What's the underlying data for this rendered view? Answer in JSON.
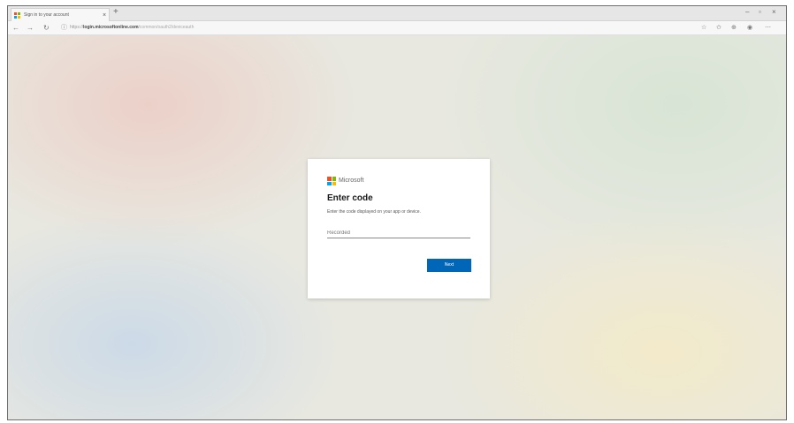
{
  "browser": {
    "tab_title": "Sign in to your account",
    "tab_close": "×",
    "new_tab": "+",
    "window_controls": {
      "minimize": "–",
      "maximize": "▫",
      "close": "×"
    },
    "nav": {
      "back": "←",
      "forward": "→",
      "refresh": "↻",
      "lock": "ⓘ"
    },
    "url": {
      "scheme": "https://",
      "host": "login.microsoftonline.com",
      "path": "/common/oauth2/deviceauth"
    },
    "toolbar_icons": [
      "☆",
      "✩",
      "⊕",
      "◉",
      "⋯"
    ]
  },
  "card": {
    "brand": "Microsoft",
    "heading": "Enter code",
    "description": "Enter the code displayed on your app or device.",
    "code_input": {
      "value": "",
      "placeholder": "Recorded"
    },
    "next_label": "Next"
  },
  "colors": {
    "accent": "#0067b8",
    "logo": [
      "#f25022",
      "#7fba00",
      "#00a4ef",
      "#ffb900"
    ]
  }
}
